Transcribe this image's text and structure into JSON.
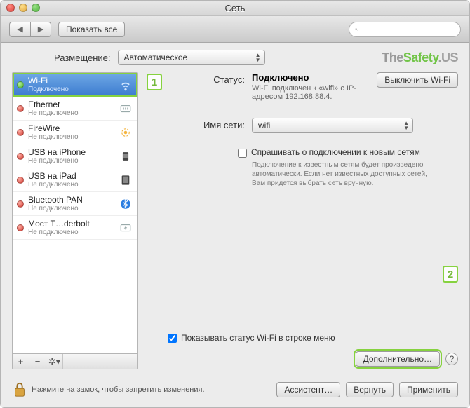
{
  "window": {
    "title": "Сеть"
  },
  "toolbar": {
    "show_all": "Показать все",
    "search_placeholder": ""
  },
  "location": {
    "label": "Размещение:",
    "value": "Автоматическое"
  },
  "brand": {
    "p1": "The",
    "p2": "Safety",
    "p3": ".US"
  },
  "sidebar": {
    "items": [
      {
        "name": "Wi-Fi",
        "status": "Подключено",
        "state": "green",
        "selected": true,
        "icon": "wifi-icon"
      },
      {
        "name": "Ethernet",
        "status": "Не подключено",
        "state": "red",
        "icon": "ethernet-icon"
      },
      {
        "name": "FireWire",
        "status": "Не подключено",
        "state": "red",
        "icon": "firewire-icon"
      },
      {
        "name": "USB на iPhone",
        "status": "Не подключено",
        "state": "red",
        "icon": "iphone-icon"
      },
      {
        "name": "USB на iPad",
        "status": "Не подключено",
        "state": "red",
        "icon": "ipad-icon"
      },
      {
        "name": "Bluetooth PAN",
        "status": "Не подключено",
        "state": "red",
        "icon": "bluetooth-icon"
      },
      {
        "name": "Мост T…derbolt",
        "status": "Не подключено",
        "state": "red",
        "icon": "thunderbolt-icon"
      }
    ]
  },
  "panel": {
    "status_label": "Статус:",
    "status_value": "Подключено",
    "status_sub": "Wi-Fi подключен к «wifi» с IP-адресом 192.168.88.4.",
    "turn_off_btn": "Выключить Wi-Fi",
    "network_label": "Имя сети:",
    "network_value": "wifi",
    "ask_checkbox": "Спрашивать о подключении к новым сетям",
    "ask_sub": "Подключение к известным сетям будет произведено автоматически. Если нет известных доступных сетей, Вам придется выбрать сеть вручную.",
    "show_status_checkbox": "Показывать статус Wi-Fi в строке меню",
    "advanced_btn": "Дополнительно…",
    "callout1": "1",
    "callout2": "2"
  },
  "footer": {
    "lock_text": "Нажмите на замок, чтобы запретить изменения.",
    "assistant_btn": "Ассистент…",
    "revert_btn": "Вернуть",
    "apply_btn": "Применить"
  }
}
